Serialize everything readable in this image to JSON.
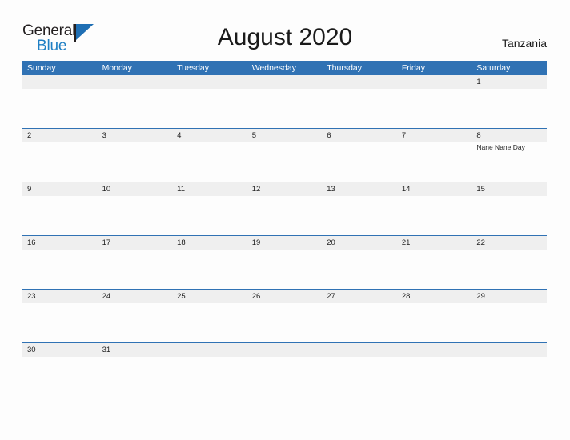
{
  "brand": {
    "name_part1": "General",
    "name_part2": "Blue",
    "flag_icon": "triangle-flag-icon"
  },
  "header": {
    "title": "August 2020",
    "country": "Tanzania"
  },
  "colors": {
    "header_blue": "#3072b4",
    "band_gray": "#efefef",
    "brand_blue": "#1f7fc4",
    "text_dark": "#222222",
    "page_background": "#fdfdfd"
  },
  "calendar": {
    "weekdays": [
      "Sunday",
      "Monday",
      "Tuesday",
      "Wednesday",
      "Thursday",
      "Friday",
      "Saturday"
    ],
    "weeks": [
      {
        "days": [
          {
            "number": "",
            "events": []
          },
          {
            "number": "",
            "events": []
          },
          {
            "number": "",
            "events": []
          },
          {
            "number": "",
            "events": []
          },
          {
            "number": "",
            "events": []
          },
          {
            "number": "",
            "events": []
          },
          {
            "number": "1",
            "events": []
          }
        ]
      },
      {
        "days": [
          {
            "number": "2",
            "events": []
          },
          {
            "number": "3",
            "events": []
          },
          {
            "number": "4",
            "events": []
          },
          {
            "number": "5",
            "events": []
          },
          {
            "number": "6",
            "events": []
          },
          {
            "number": "7",
            "events": []
          },
          {
            "number": "8",
            "events": [
              "Nane Nane Day"
            ]
          }
        ]
      },
      {
        "days": [
          {
            "number": "9",
            "events": []
          },
          {
            "number": "10",
            "events": []
          },
          {
            "number": "11",
            "events": []
          },
          {
            "number": "12",
            "events": []
          },
          {
            "number": "13",
            "events": []
          },
          {
            "number": "14",
            "events": []
          },
          {
            "number": "15",
            "events": []
          }
        ]
      },
      {
        "days": [
          {
            "number": "16",
            "events": []
          },
          {
            "number": "17",
            "events": []
          },
          {
            "number": "18",
            "events": []
          },
          {
            "number": "19",
            "events": []
          },
          {
            "number": "20",
            "events": []
          },
          {
            "number": "21",
            "events": []
          },
          {
            "number": "22",
            "events": []
          }
        ]
      },
      {
        "days": [
          {
            "number": "23",
            "events": []
          },
          {
            "number": "24",
            "events": []
          },
          {
            "number": "25",
            "events": []
          },
          {
            "number": "26",
            "events": []
          },
          {
            "number": "27",
            "events": []
          },
          {
            "number": "28",
            "events": []
          },
          {
            "number": "29",
            "events": []
          }
        ]
      },
      {
        "days": [
          {
            "number": "30",
            "events": []
          },
          {
            "number": "31",
            "events": []
          },
          {
            "number": "",
            "events": []
          },
          {
            "number": "",
            "events": []
          },
          {
            "number": "",
            "events": []
          },
          {
            "number": "",
            "events": []
          },
          {
            "number": "",
            "events": []
          }
        ]
      }
    ]
  }
}
